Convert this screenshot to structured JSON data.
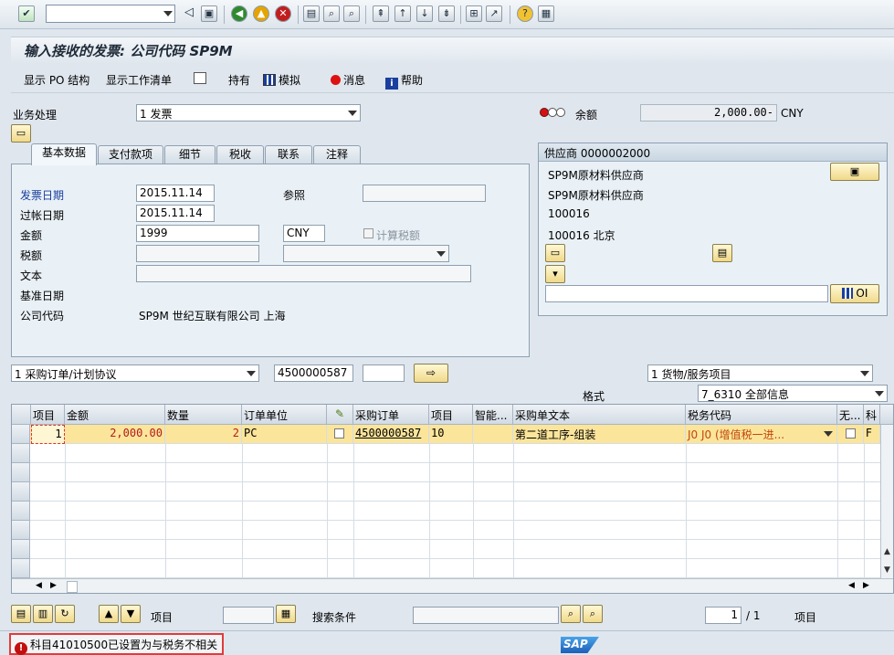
{
  "toolbar": {
    "command_field": "",
    "icons": [
      "enter-icon",
      "back-icon",
      "save-icon",
      "back-nav-icon",
      "exit-icon",
      "cancel-icon",
      "print-icon",
      "find-icon",
      "find-next-icon",
      "first-page-icon",
      "prev-page-icon",
      "next-page-icon",
      "last-page-icon",
      "new-session-icon",
      "shortcut-icon",
      "help-icon",
      "layout-icon"
    ]
  },
  "title": "输入接收的发票: 公司代码 SP9M",
  "app_toolbar": {
    "show_po_structure": "显示 PO 结构",
    "show_worklist": "显示工作清单",
    "hold": "持有",
    "simulate": "模拟",
    "messages": "消息",
    "help": "帮助"
  },
  "header": {
    "transaction_label": "业务处理",
    "transaction_value": "1 发票",
    "balance_label": "余额",
    "balance_value": "2,000.00-",
    "balance_currency": "CNY"
  },
  "tabs": [
    "基本数据",
    "支付款项",
    "细节",
    "税收",
    "联系",
    "注释"
  ],
  "basic": {
    "invoice_date_label": "发票日期",
    "invoice_date": "2015.11.14",
    "reference_label": "参照",
    "reference": "",
    "posting_date_label": "过帐日期",
    "posting_date": "2015.11.14",
    "amount_label": "金额",
    "amount": "1999",
    "currency": "CNY",
    "calc_tax_label": "计算税额",
    "tax_label": "税额",
    "tax": "",
    "text_label": "文本",
    "text": "",
    "baseline_label": "基准日期",
    "company_label": "公司代码",
    "company_value": "SP9M 世纪互联有限公司 上海"
  },
  "vendor": {
    "header": "供应商 0000002000",
    "name1": "SP9M原材料供应商",
    "name2": "SP9M原材料供应商",
    "postal": "100016",
    "city": "100016 北京",
    "oi_button": "OI",
    "field": ""
  },
  "reference_row": {
    "doc_type": "1 采购订单/计划协议",
    "po_number": "4500000587",
    "item": "",
    "item_type": "1 货物/服务项目",
    "layout_label": "格式",
    "layout_value": "7_6310 全部信息"
  },
  "grid": {
    "columns": [
      "项目",
      "金额",
      "数量",
      "订单单位",
      "",
      "采购订单",
      "项目",
      "智能...",
      "采购单文本",
      "税务代码",
      "无...",
      "科"
    ],
    "rows": [
      {
        "item": "1",
        "amount": "2,000.00",
        "quantity": "2",
        "unit": "PC",
        "po": "4500000587",
        "po_item": "10",
        "smart": "",
        "text": "第二道工序-组装",
        "tax_code": "J0 J0 (增值税一进...",
        "acct": "F"
      }
    ]
  },
  "bottom": {
    "item_label": "项目",
    "item_value": "",
    "search_label": "搜索条件",
    "search_value": "",
    "page_current": "1",
    "page_total": "/ 1",
    "item_label2": "项目"
  },
  "status": {
    "message": "科目41010500已设置为与税务不相关",
    "logo": "SAP"
  },
  "colors": {
    "highlight_row": "#fbe59b",
    "error": "#c40f0f",
    "label_blue": "#1a3c9e"
  }
}
